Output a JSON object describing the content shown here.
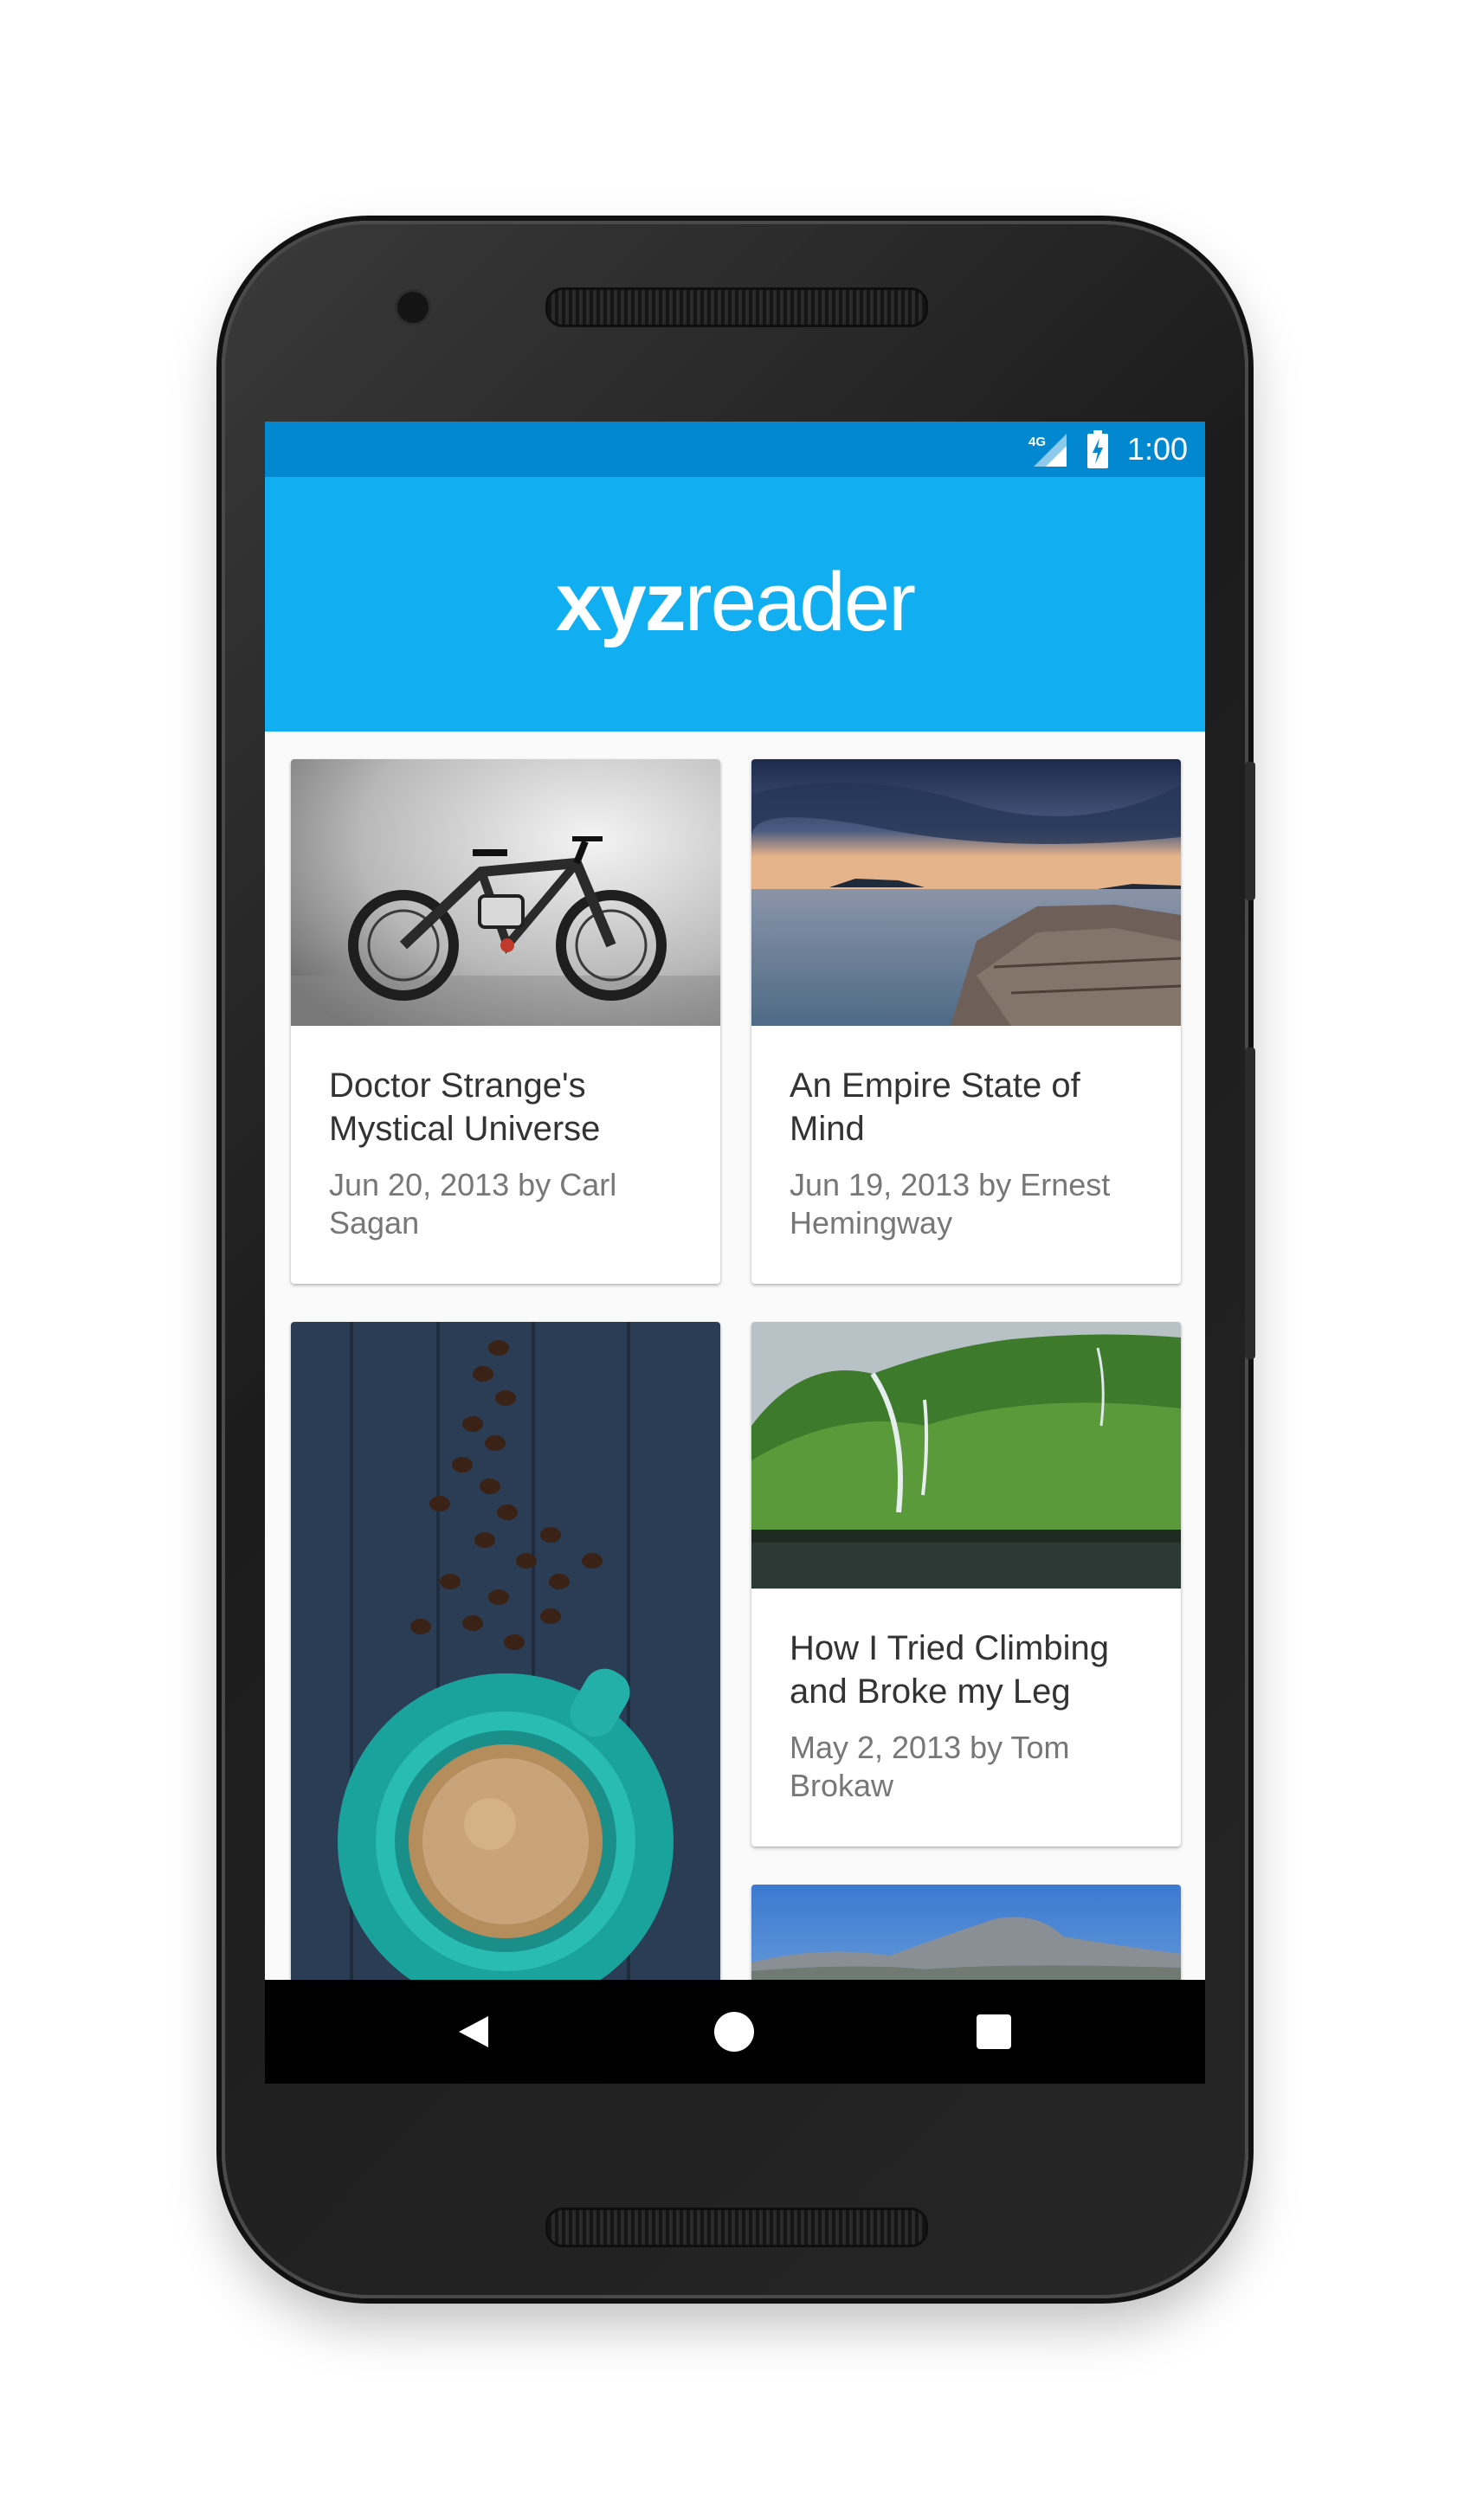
{
  "status_bar": {
    "time": "1:00",
    "network": "4G",
    "icons": [
      "signal-icon",
      "battery-charging-icon"
    ],
    "color": "#0288d1"
  },
  "app_bar": {
    "logo_bold": "xyz",
    "logo_regular": "reader",
    "color": "#12aef2"
  },
  "articles": [
    {
      "title": "Doctor Strange's Mystical Universe",
      "subtitle": "Jun 20, 2013 by Carl Sagan",
      "image": "bicycle-photo"
    },
    {
      "title": "An Empire State of Mind",
      "subtitle": "Jun 19, 2013 by Ernest Hemingway",
      "image": "seaside-rocks-photo"
    },
    {
      "title": "",
      "subtitle": "",
      "image": "coffee-beans-photo"
    },
    {
      "title": "How I Tried Climbing and Broke my Leg",
      "subtitle": "May 2, 2013 by Tom Brokaw",
      "image": "green-cliffs-waterfall-photo"
    },
    {
      "title": "",
      "subtitle": "",
      "image": "half-dome-mountain-photo"
    }
  ],
  "nav_bar": {
    "icons": [
      "back-icon",
      "home-icon",
      "recents-icon"
    ]
  }
}
